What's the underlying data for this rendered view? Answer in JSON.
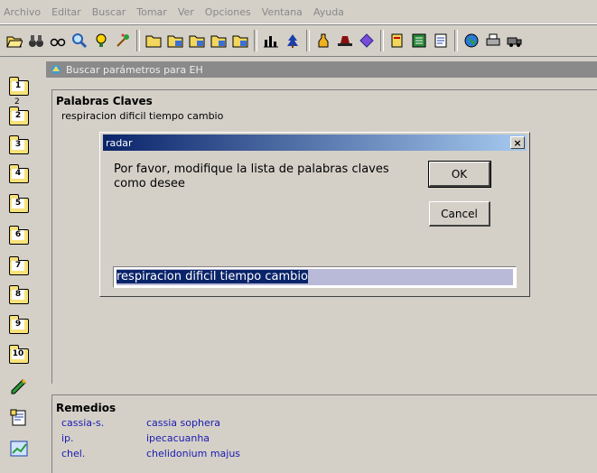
{
  "menu": [
    "Archivo",
    "Editar",
    "Buscar",
    "Tomar",
    "Ver",
    "Opciones",
    "Ventana",
    "Ayuda"
  ],
  "inner_window": {
    "title": "Buscar parámetros para EH"
  },
  "keywords": {
    "heading": "Palabras Claves",
    "value": "respiracion dificil tiempo cambio"
  },
  "remedies": {
    "heading": "Remedios",
    "rows": [
      {
        "abbr": "cassia-s.",
        "name": "cassia sophera"
      },
      {
        "abbr": "ip.",
        "name": "ipecacuanha"
      },
      {
        "abbr": "chel.",
        "name": "chelidonium majus"
      }
    ]
  },
  "dialog": {
    "title": "radar",
    "close": "×",
    "message": "Por favor, modifique la lista de palabras claves como desee",
    "ok_label": "OK",
    "cancel_label": "Cancel",
    "input_value": "respiracion dificil tiempo cambio"
  },
  "leftbar": {
    "items": [
      "1",
      "2",
      "3",
      "4",
      "5",
      "6",
      "7",
      "8",
      "9",
      "10"
    ],
    "superscript": "2"
  },
  "toolbar_icons": [
    "open-folder-icon",
    "binoculars-icon",
    "glasses-icon",
    "magnifier-icon",
    "lightbulb-icon",
    "sparkle-icon",
    "folder-icon",
    "folder-1-icon",
    "folder-2-icon",
    "folder-3-icon",
    "folder-4-icon",
    "bar-chart-icon",
    "tree-icon",
    "bottle-icon",
    "hat-icon",
    "diamond-icon",
    "book-icon",
    "list-icon",
    "document-icon",
    "globe-icon",
    "printer-icon",
    "truck-icon"
  ]
}
